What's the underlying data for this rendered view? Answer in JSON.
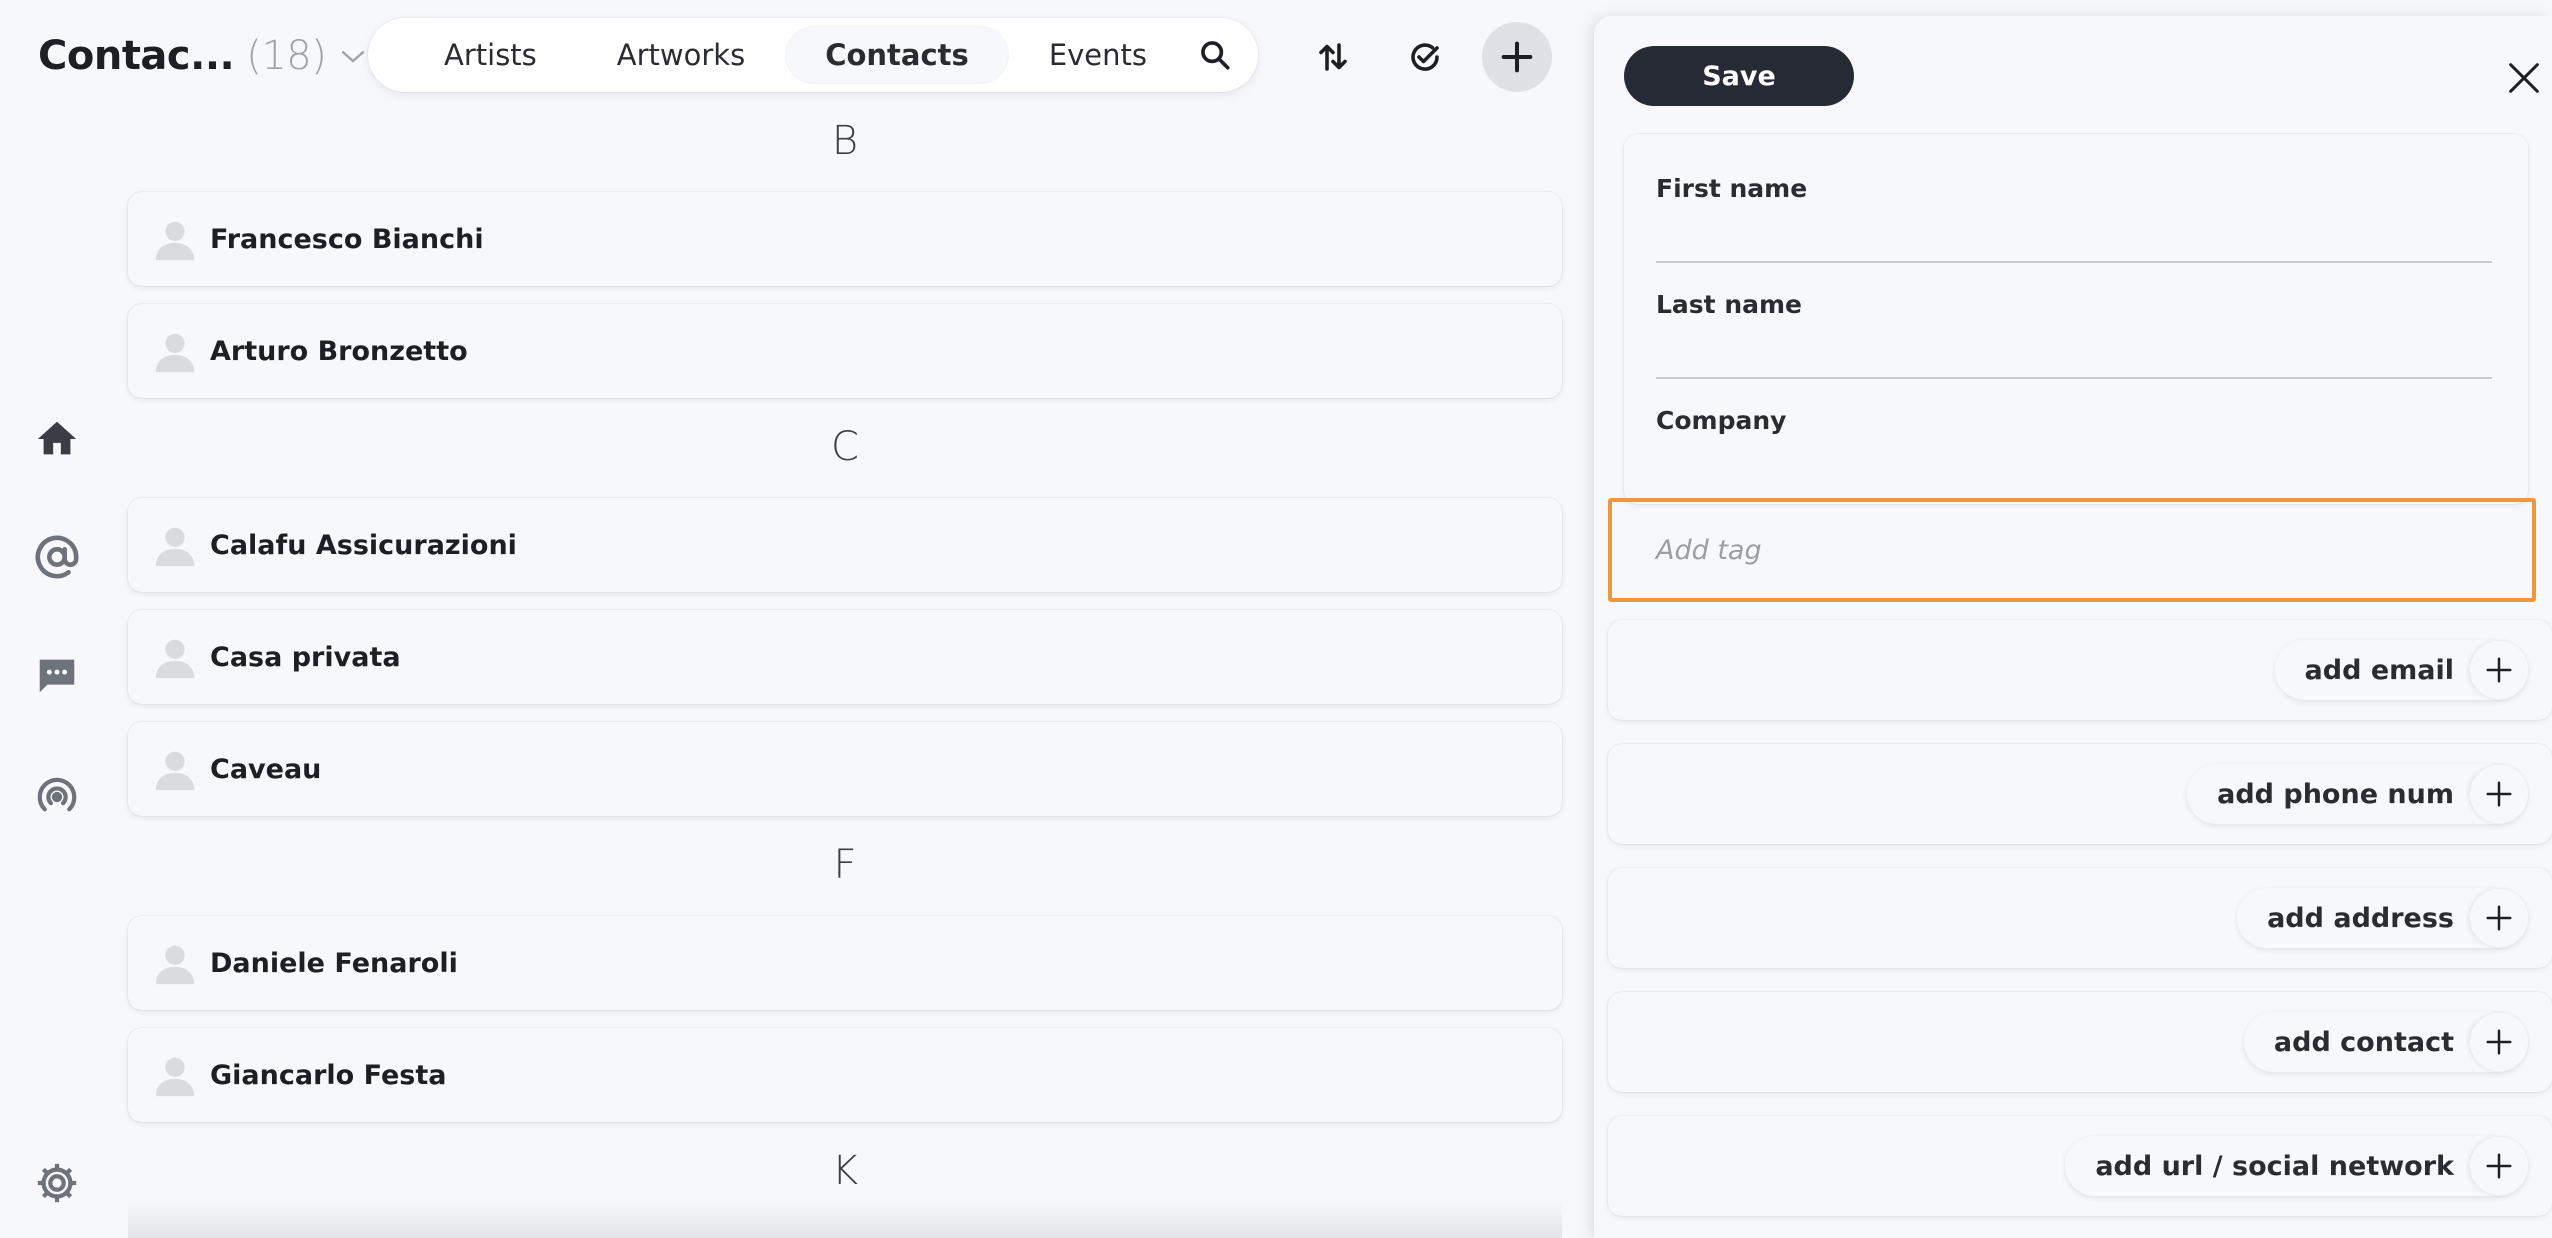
{
  "header": {
    "title": "Contac...",
    "count": "(18)",
    "tabs": [
      {
        "label": "Artists"
      },
      {
        "label": "Artworks"
      },
      {
        "label": "Contacts",
        "active": true
      },
      {
        "label": "Events"
      }
    ]
  },
  "icons": {
    "search": "search-icon",
    "sort": "sort-icon",
    "select": "check-circle-icon",
    "add": "plus-icon",
    "close": "close-icon",
    "rail": [
      "home-icon",
      "at-icon",
      "chat-icon",
      "broadcast-icon",
      "gear-icon"
    ]
  },
  "contacts": {
    "groups": [
      {
        "letter": "B",
        "items": [
          "Francesco Bianchi",
          "Arturo Bronzetto"
        ]
      },
      {
        "letter": "C",
        "items": [
          "Calafu Assicurazioni",
          "Casa privata",
          "Caveau"
        ]
      },
      {
        "letter": "F",
        "items": [
          "Daniele Fenaroli",
          "Giancarlo Festa"
        ]
      },
      {
        "letter": "K",
        "items": []
      }
    ]
  },
  "panel": {
    "save_label": "Save",
    "fields": {
      "first_name": "First name",
      "last_name": "Last name",
      "company": "Company"
    },
    "tag_placeholder": "Add tag",
    "add_email": "add email",
    "add_phone": "add phone num",
    "add_address": "add address",
    "add_contact": "add contact",
    "add_url": "add url / social network"
  },
  "colors": {
    "accent_focus": "#f0973b",
    "save_button": "#252a34",
    "background": "#f7f8fb"
  }
}
